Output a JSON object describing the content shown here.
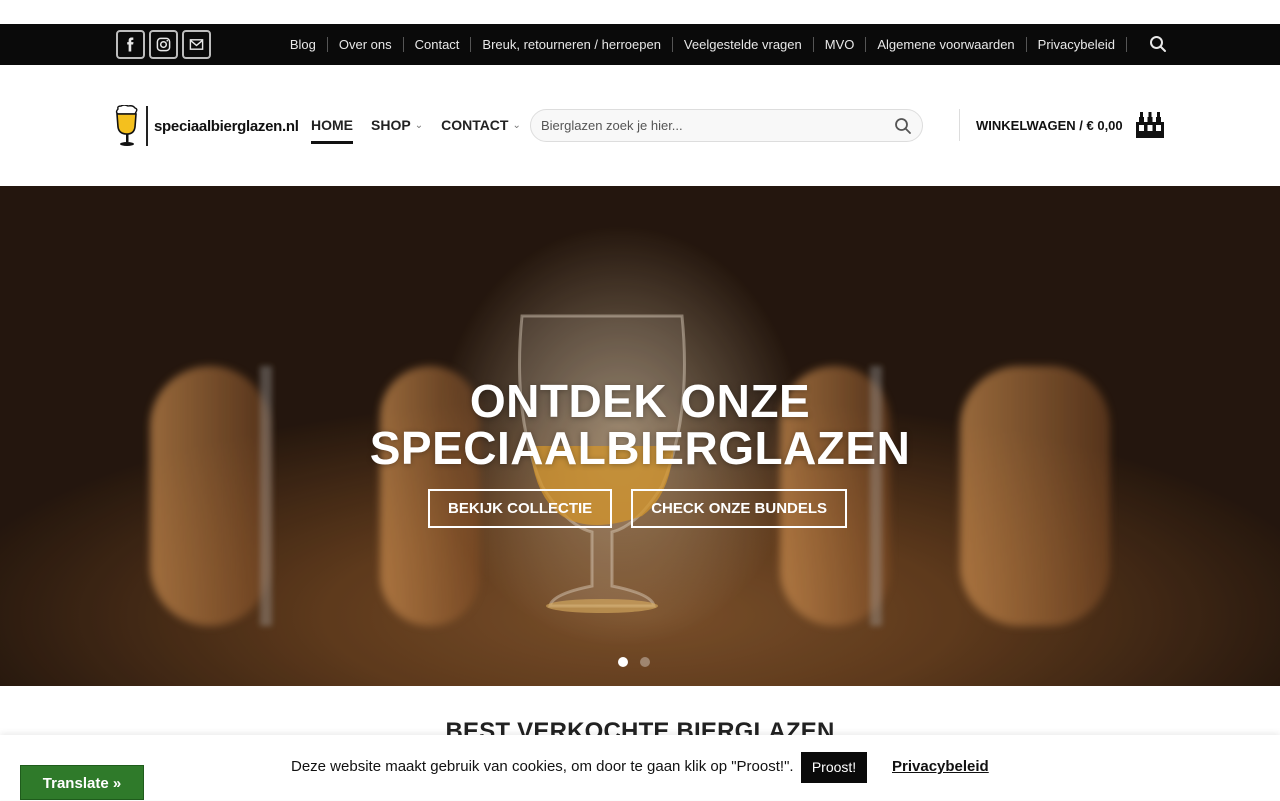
{
  "topbar": {
    "social": [
      {
        "name": "facebook-icon"
      },
      {
        "name": "instagram-icon"
      },
      {
        "name": "mail-icon"
      }
    ],
    "links": [
      "Blog",
      "Over ons",
      "Contact",
      "Breuk, retourneren / herroepen",
      "Veelgestelde vragen",
      "MVO",
      "Algemene voorwaarden",
      "Privacybeleid"
    ]
  },
  "header": {
    "logo_text": "speciaalbierglazen.nl",
    "nav": [
      {
        "label": "HOME"
      },
      {
        "label": "SHOP"
      },
      {
        "label": "CONTACT"
      }
    ],
    "search_placeholder": "Bierglazen zoek je hier...",
    "cart_label": "WINKELWAGEN / € 0,00"
  },
  "hero": {
    "title_line1": "ONTDEK ONZE",
    "title_line2": "SPECIAALBIERGLAZEN",
    "button_primary": "BEKIJK COLLECTIE",
    "button_secondary": "CHECK ONZE BUNDELS",
    "slide_count": 2,
    "active_slide": 1
  },
  "section": {
    "title": "BEST VERKOCHTE BIERGLAZEN"
  },
  "cookie": {
    "message": "Deze website maakt gebruik van cookies, om door te gaan klik op \"Proost!\".",
    "accept_label": "Proost!",
    "privacy_label": "Privacybeleid"
  },
  "translate": {
    "label": "Translate »"
  }
}
